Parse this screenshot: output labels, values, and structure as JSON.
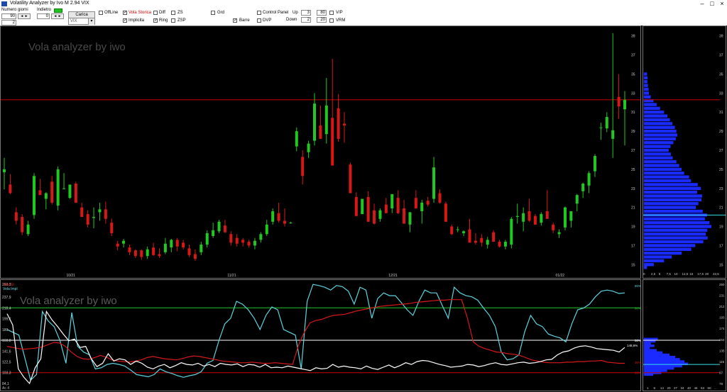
{
  "window": {
    "title": "Volatility Analyzer by Ivo M 2.94  VIX"
  },
  "toolbar": {
    "numero_giorni_label": "Numero giorni",
    "numero_giorni_value": "90",
    "numero_giorni_value2": "2",
    "indietro_label": "Indietro",
    "indietro_value": "0",
    "spin_arrows": "◄ ►",
    "carica_label": "Carica",
    "symbol_value": "VIX",
    "offline_label": "OffLine",
    "vola_storica_label": "Vola Storica",
    "implicita_label": "Implicita",
    "diff_label": "Diff",
    "ring_label": "Ring",
    "zs_label": "ZS",
    "zsp_label": "ZSP",
    "grid_label": "Grd",
    "barre_label": "Barre",
    "control_panel_label": "Control Panel",
    "dvp_label": "DVP",
    "up_label": "Up",
    "up_value1": "3",
    "up_value2": "80",
    "down_label": "Down",
    "down_value1": "2",
    "down_value2": "20",
    "vp_label": "V/P",
    "vrm_label": "VRM",
    "check_mark": "✓"
  },
  "main_chart": {
    "watermark": "Vola analyzer by iwo",
    "x_ticks": [
      "10/21",
      "11/21",
      "12/21",
      "01/22"
    ],
    "y_ticks": [
      "39",
      "37",
      "35",
      "33",
      "31",
      "29",
      "27",
      "25",
      "23",
      "21",
      "19",
      "17",
      "15"
    ],
    "ylim": [
      14.5,
      39.5
    ],
    "hline_red": 32.3,
    "colors": {
      "up": "#22c822",
      "down": "#d81818",
      "hline": "#c80000"
    }
  },
  "volume_profile": {
    "x_ticks": [
      "0",
      "2,5",
      "5",
      "7,5",
      "10",
      "12,5",
      "15",
      "17,5",
      "20",
      "22,5"
    ],
    "x_label": "10,6 15",
    "red_line": 32.3,
    "cyan_line": 20.2
  },
  "lower_chart": {
    "watermark": "Vola analyzer by iwo",
    "legend_line1": "Vola St",
    "legend_line2": "Vola Impl",
    "left_ticks": [
      "260,3",
      "237,9",
      "218,4",
      "199,2",
      "180",
      "160,8",
      "141,6",
      "122,5",
      "103,3",
      "84,1"
    ],
    "right_ticks": [
      "250",
      "231",
      "212",
      "193",
      "174",
      "154",
      "135",
      "116",
      "97",
      "78"
    ],
    "bottom_left": "Ac 4",
    "pct_labels": {
      "top": "90%",
      "green": "80%",
      "white": "50%",
      "white_value": "148,6%",
      "red_mid": "30%",
      "red_low": "20%"
    },
    "hist_x_ticks": [
      "1",
      "8",
      "14",
      "20",
      "27",
      "34",
      "40",
      "46",
      "53",
      "60",
      "..."
    ]
  },
  "chart_data": {
    "type": "candlestick",
    "title": "Vola analyzer by iwo",
    "symbol": "VIX",
    "candles": [
      {
        "o": 24.7,
        "h": 26.2,
        "l": 22.9,
        "c": 25.0
      },
      {
        "o": 23.4,
        "h": 24.5,
        "l": 22.4,
        "c": 22.5
      },
      {
        "o": 20.5,
        "h": 21.0,
        "l": 19.2,
        "c": 19.6
      },
      {
        "o": 20.0,
        "h": 20.3,
        "l": 18.1,
        "c": 18.4
      },
      {
        "o": 18.2,
        "h": 19.6,
        "l": 18.0,
        "c": 19.2
      },
      {
        "o": 20.2,
        "h": 24.6,
        "l": 19.8,
        "c": 24.3
      },
      {
        "o": 22.8,
        "h": 24.0,
        "l": 22.5,
        "c": 22.3
      },
      {
        "o": 21.9,
        "h": 22.6,
        "l": 20.8,
        "c": 22.5
      },
      {
        "o": 23.7,
        "h": 24.3,
        "l": 21.3,
        "c": 21.5
      },
      {
        "o": 21.2,
        "h": 25.3,
        "l": 20.7,
        "c": 25.0
      },
      {
        "o": 23.0,
        "h": 24.6,
        "l": 22.9,
        "c": 23.0
      },
      {
        "o": 22.0,
        "h": 23.3,
        "l": 21.9,
        "c": 23.4
      },
      {
        "o": 23.5,
        "h": 23.7,
        "l": 21.5,
        "c": 21.5
      },
      {
        "o": 21.0,
        "h": 21.5,
        "l": 20.0,
        "c": 20.0
      },
      {
        "o": 20.3,
        "h": 20.7,
        "l": 18.9,
        "c": 19.2
      },
      {
        "o": 19.9,
        "h": 21.0,
        "l": 18.8,
        "c": 20.0
      },
      {
        "o": 20.5,
        "h": 21.5,
        "l": 19.6,
        "c": 20.8
      },
      {
        "o": 20.8,
        "h": 21.6,
        "l": 19.3,
        "c": 19.8
      },
      {
        "o": 19.4,
        "h": 19.8,
        "l": 18.0,
        "c": 18.3
      },
      {
        "o": 17.2,
        "h": 17.5,
        "l": 16.5,
        "c": 16.9
      },
      {
        "o": 17.2,
        "h": 17.7,
        "l": 16.8,
        "c": 17.5
      },
      {
        "o": 16.8,
        "h": 17.1,
        "l": 16.0,
        "c": 16.3
      },
      {
        "o": 16.5,
        "h": 16.6,
        "l": 15.7,
        "c": 15.9
      },
      {
        "o": 16.5,
        "h": 16.6,
        "l": 15.5,
        "c": 15.8
      },
      {
        "o": 15.9,
        "h": 16.9,
        "l": 15.6,
        "c": 16.6
      },
      {
        "o": 16.8,
        "h": 17.3,
        "l": 15.9,
        "c": 16.0
      },
      {
        "o": 16.1,
        "h": 16.7,
        "l": 15.7,
        "c": 15.9
      },
      {
        "o": 16.3,
        "h": 17.8,
        "l": 16.1,
        "c": 17.2
      },
      {
        "o": 16.8,
        "h": 17.7,
        "l": 16.3,
        "c": 17.6
      },
      {
        "o": 17.6,
        "h": 17.8,
        "l": 16.4,
        "c": 16.9
      },
      {
        "o": 17.3,
        "h": 17.6,
        "l": 16.6,
        "c": 16.8
      },
      {
        "o": 16.7,
        "h": 17.1,
        "l": 15.8,
        "c": 16.0
      },
      {
        "o": 16.1,
        "h": 16.6,
        "l": 15.4,
        "c": 15.6
      },
      {
        "o": 16.3,
        "h": 17.4,
        "l": 16.0,
        "c": 17.1
      },
      {
        "o": 17.1,
        "h": 18.6,
        "l": 16.8,
        "c": 18.3
      },
      {
        "o": 18.0,
        "h": 19.4,
        "l": 17.8,
        "c": 18.6
      },
      {
        "o": 18.5,
        "h": 19.7,
        "l": 18.3,
        "c": 19.5
      },
      {
        "o": 19.1,
        "h": 19.7,
        "l": 18.3,
        "c": 18.4
      },
      {
        "o": 18.2,
        "h": 18.5,
        "l": 17.0,
        "c": 17.3
      },
      {
        "o": 17.8,
        "h": 18.2,
        "l": 16.9,
        "c": 17.2
      },
      {
        "o": 17.6,
        "h": 17.8,
        "l": 16.9,
        "c": 17.3
      },
      {
        "o": 17.4,
        "h": 17.6,
        "l": 16.8,
        "c": 17.0
      },
      {
        "o": 17.0,
        "h": 17.8,
        "l": 16.6,
        "c": 17.5
      },
      {
        "o": 17.6,
        "h": 18.4,
        "l": 17.3,
        "c": 18.2
      },
      {
        "o": 18.2,
        "h": 19.7,
        "l": 18.0,
        "c": 19.2
      },
      {
        "o": 19.5,
        "h": 20.9,
        "l": 19.2,
        "c": 20.6
      },
      {
        "o": 20.4,
        "h": 21.5,
        "l": 19.4,
        "c": 19.6
      },
      {
        "o": 19.6,
        "h": 20.9,
        "l": 19.0,
        "c": 19.3
      },
      {
        "o": 19.4,
        "h": 19.5,
        "l": 19.3,
        "c": 19.4
      },
      {
        "o": 27.4,
        "h": 29.4,
        "l": 26.9,
        "c": 29.0
      },
      {
        "o": 26.3,
        "h": 27.0,
        "l": 23.4,
        "c": 24.3
      },
      {
        "o": 26.8,
        "h": 28.0,
        "l": 26.2,
        "c": 27.7
      },
      {
        "o": 28.0,
        "h": 33.0,
        "l": 27.5,
        "c": 31.9
      },
      {
        "o": 29.6,
        "h": 31.7,
        "l": 28.4,
        "c": 28.2
      },
      {
        "o": 28.7,
        "h": 34.6,
        "l": 27.7,
        "c": 31.7
      },
      {
        "o": 30.4,
        "h": 36.6,
        "l": 25.4,
        "c": 25.4
      },
      {
        "o": 31.4,
        "h": 32.9,
        "l": 27.9,
        "c": 28.2
      },
      {
        "o": 29.8,
        "h": 31.0,
        "l": 27.8,
        "c": 29.6
      },
      {
        "o": 25.5,
        "h": 25.7,
        "l": 22.6,
        "c": 22.5
      },
      {
        "o": 22.1,
        "h": 22.6,
        "l": 20.1,
        "c": 20.1
      },
      {
        "o": 20.3,
        "h": 21.9,
        "l": 20.3,
        "c": 21.9
      },
      {
        "o": 22.1,
        "h": 22.7,
        "l": 19.5,
        "c": 19.5
      },
      {
        "o": 20.7,
        "h": 21.4,
        "l": 19.2,
        "c": 19.3
      },
      {
        "o": 19.8,
        "h": 20.9,
        "l": 19.5,
        "c": 20.7
      },
      {
        "o": 21.3,
        "h": 22.0,
        "l": 20.4,
        "c": 20.4
      },
      {
        "o": 20.9,
        "h": 22.3,
        "l": 20.4,
        "c": 22.4
      },
      {
        "o": 22.0,
        "h": 22.8,
        "l": 20.3,
        "c": 20.4
      },
      {
        "o": 20.9,
        "h": 21.8,
        "l": 19.3,
        "c": 19.3
      },
      {
        "o": 19.2,
        "h": 20.5,
        "l": 18.4,
        "c": 20.5
      },
      {
        "o": 22.0,
        "h": 22.8,
        "l": 20.9,
        "c": 20.9
      },
      {
        "o": 20.6,
        "h": 21.8,
        "l": 19.3,
        "c": 21.5
      },
      {
        "o": 21.7,
        "h": 22.1,
        "l": 21.1,
        "c": 21.3
      },
      {
        "o": 21.9,
        "h": 26.3,
        "l": 21.5,
        "c": 25.2
      },
      {
        "o": 22.5,
        "h": 22.9,
        "l": 21.4,
        "c": 21.5
      },
      {
        "o": 21.4,
        "h": 21.6,
        "l": 19.5,
        "c": 19.5
      },
      {
        "o": 19.0,
        "h": 19.2,
        "l": 18.1,
        "c": 18.2
      },
      {
        "o": 18.7,
        "h": 19.0,
        "l": 18.4,
        "c": 18.7
      },
      {
        "o": 18.3,
        "h": 18.6,
        "l": 18.0,
        "c": 18.5
      },
      {
        "o": 18.7,
        "h": 19.8,
        "l": 17.3,
        "c": 17.3
      },
      {
        "o": 17.5,
        "h": 18.3,
        "l": 17.1,
        "c": 17.3
      },
      {
        "o": 17.8,
        "h": 18.2,
        "l": 16.9,
        "c": 17.3
      },
      {
        "o": 17.1,
        "h": 17.9,
        "l": 16.7,
        "c": 17.6
      },
      {
        "o": 18.4,
        "h": 18.6,
        "l": 17.4,
        "c": 17.4
      },
      {
        "o": 17.4,
        "h": 17.6,
        "l": 16.8,
        "c": 16.9
      },
      {
        "o": 16.9,
        "h": 17.6,
        "l": 16.6,
        "c": 17.4
      },
      {
        "o": 17.1,
        "h": 20.0,
        "l": 16.7,
        "c": 19.8
      },
      {
        "o": 20.0,
        "h": 21.4,
        "l": 19.3,
        "c": 20.1
      },
      {
        "o": 19.5,
        "h": 21.0,
        "l": 18.5,
        "c": 20.4
      },
      {
        "o": 20.6,
        "h": 21.9,
        "l": 19.5,
        "c": 19.6
      },
      {
        "o": 20.1,
        "h": 20.3,
        "l": 19.2,
        "c": 19.2
      },
      {
        "o": 19.4,
        "h": 20.5,
        "l": 19.1,
        "c": 20.3
      },
      {
        "o": 20.6,
        "h": 22.8,
        "l": 19.8,
        "c": 19.8
      },
      {
        "o": 19.2,
        "h": 19.4,
        "l": 18.3,
        "c": 18.6
      },
      {
        "o": 18.2,
        "h": 18.7,
        "l": 17.8,
        "c": 18.4
      },
      {
        "o": 18.9,
        "h": 21.1,
        "l": 18.6,
        "c": 21.0
      },
      {
        "o": 19.6,
        "h": 20.6,
        "l": 18.9,
        "c": 20.6
      },
      {
        "o": 21.4,
        "h": 22.4,
        "l": 20.6,
        "c": 22.3
      },
      {
        "o": 22.7,
        "h": 23.6,
        "l": 22.0,
        "c": 23.5
      },
      {
        "o": 23.3,
        "h": 24.8,
        "l": 22.5,
        "c": 24.6
      },
      {
        "o": 24.8,
        "h": 26.6,
        "l": 24.2,
        "c": 26.4
      },
      {
        "o": 29.4,
        "h": 29.9,
        "l": 28.1,
        "c": 29.4
      },
      {
        "o": 29.3,
        "h": 31.0,
        "l": 28.9,
        "c": 30.5
      },
      {
        "o": 28.2,
        "h": 39.3,
        "l": 26.2,
        "c": 29.1
      },
      {
        "o": 32.6,
        "h": 35.0,
        "l": 30.3,
        "c": 31.6
      },
      {
        "o": 31.3,
        "h": 33.2,
        "l": 27.5,
        "c": 32.3
      }
    ],
    "volume_profile": [
      {
        "p": 35.0,
        "v": 1.0
      },
      {
        "p": 34.6,
        "v": 1.2
      },
      {
        "p": 34.2,
        "v": 1.1
      },
      {
        "p": 33.8,
        "v": 1.3
      },
      {
        "p": 33.4,
        "v": 1.5
      },
      {
        "p": 33.0,
        "v": 1.6
      },
      {
        "p": 32.6,
        "v": 2.2
      },
      {
        "p": 32.2,
        "v": 3.1
      },
      {
        "p": 31.8,
        "v": 4.1
      },
      {
        "p": 31.4,
        "v": 5.2
      },
      {
        "p": 31.0,
        "v": 6.5
      },
      {
        "p": 30.6,
        "v": 7.6
      },
      {
        "p": 30.2,
        "v": 8.4
      },
      {
        "p": 29.8,
        "v": 9.2
      },
      {
        "p": 29.4,
        "v": 10.0
      },
      {
        "p": 29.0,
        "v": 10.5
      },
      {
        "p": 28.6,
        "v": 10.8
      },
      {
        "p": 28.2,
        "v": 10.3
      },
      {
        "p": 27.8,
        "v": 9.5
      },
      {
        "p": 27.4,
        "v": 8.6
      },
      {
        "p": 27.0,
        "v": 8.0
      },
      {
        "p": 26.6,
        "v": 8.7
      },
      {
        "p": 26.2,
        "v": 9.3
      },
      {
        "p": 25.8,
        "v": 10.5
      },
      {
        "p": 25.4,
        "v": 11.4
      },
      {
        "p": 25.0,
        "v": 12.2
      },
      {
        "p": 24.6,
        "v": 13.0
      },
      {
        "p": 24.2,
        "v": 14.6
      },
      {
        "p": 23.8,
        "v": 15.2
      },
      {
        "p": 23.4,
        "v": 17.4
      },
      {
        "p": 23.0,
        "v": 18.4
      },
      {
        "p": 22.6,
        "v": 17.2
      },
      {
        "p": 22.2,
        "v": 18.8
      },
      {
        "p": 21.8,
        "v": 18.6
      },
      {
        "p": 21.4,
        "v": 17.6
      },
      {
        "p": 21.0,
        "v": 16.8
      },
      {
        "p": 20.6,
        "v": 19.0
      },
      {
        "p": 20.2,
        "v": 20.4
      },
      {
        "p": 19.8,
        "v": 19.7
      },
      {
        "p": 19.4,
        "v": 21.2
      },
      {
        "p": 19.0,
        "v": 21.8
      },
      {
        "p": 18.6,
        "v": 20.5
      },
      {
        "p": 18.2,
        "v": 20.0
      },
      {
        "p": 17.8,
        "v": 20.6
      },
      {
        "p": 17.4,
        "v": 19.2
      },
      {
        "p": 17.0,
        "v": 16.6
      },
      {
        "p": 16.6,
        "v": 15.3
      },
      {
        "p": 16.2,
        "v": 12.2
      },
      {
        "p": 15.8,
        "v": 9.0
      },
      {
        "p": 15.4,
        "v": 6.5
      },
      {
        "p": 15.0,
        "v": 3.2
      },
      {
        "p": 14.7,
        "v": 1.0
      }
    ],
    "vola_storica": [
      150,
      148,
      146,
      145,
      146,
      147,
      149,
      153,
      157,
      156,
      150,
      140,
      132,
      128,
      127,
      130,
      134,
      131,
      126,
      124,
      123,
      122,
      124,
      126,
      130,
      132,
      130,
      128,
      127,
      126,
      128,
      131,
      133,
      132,
      130,
      128,
      126,
      124,
      123,
      122,
      121,
      121,
      122,
      121,
      120,
      120,
      121,
      120,
      119,
      118,
      152,
      175,
      192,
      196,
      198,
      202,
      205,
      206,
      207,
      210,
      213,
      215,
      217,
      219,
      221,
      222,
      223,
      224,
      225,
      226,
      228,
      229,
      230,
      231,
      232,
      232,
      233,
      233,
      233,
      200,
      158,
      150,
      146,
      143,
      140,
      139,
      137,
      136,
      134,
      130,
      126,
      124,
      122,
      121,
      121,
      121,
      122,
      122,
      123,
      123,
      124,
      124,
      125,
      122,
      121,
      120,
      120
    ],
    "vola_impl": [
      208,
      188,
      110,
      95,
      82,
      112,
      128,
      212,
      197,
      185,
      172,
      160,
      163,
      148,
      150,
      128,
      114,
      120,
      137,
      124,
      128,
      126,
      118,
      124,
      120,
      113,
      110,
      115,
      118,
      112,
      116,
      121,
      118,
      117,
      120,
      115,
      118,
      114,
      120,
      118,
      117,
      119,
      114,
      118,
      117,
      113,
      118,
      112,
      113,
      112,
      115,
      113,
      111,
      109,
      107,
      112,
      110,
      111,
      118,
      113,
      115,
      113,
      112,
      110,
      115,
      111,
      109,
      113,
      117,
      112,
      116,
      121,
      118,
      123,
      125,
      124,
      121,
      118,
      116,
      113,
      114,
      115,
      118,
      117,
      114,
      116,
      119,
      121,
      118,
      117,
      119,
      121,
      122,
      120,
      121,
      123,
      126,
      127,
      135,
      140,
      142,
      147,
      150,
      151,
      149,
      146,
      145,
      144,
      143,
      140,
      148
    ],
    "vola_impl_cyan": [
      180,
      175,
      170,
      130,
      90,
      100,
      212,
      195,
      185,
      160,
      120,
      210,
      150,
      140,
      135,
      110,
      112,
      118,
      120,
      118,
      115,
      108,
      100,
      98,
      96,
      100,
      110,
      105,
      102,
      98,
      95,
      98,
      100,
      105,
      120,
      125,
      160,
      190,
      200,
      230,
      225,
      215,
      200,
      180,
      205,
      220,
      215,
      180,
      175,
      170,
      110,
      230,
      260,
      258,
      255,
      250,
      258,
      256,
      248,
      225,
      255,
      250,
      200,
      235,
      245,
      240,
      240,
      228,
      215,
      205,
      230,
      250,
      245,
      245,
      222,
      200,
      255,
      245,
      240,
      238,
      232,
      218,
      205,
      185,
      140,
      126,
      128,
      135,
      176,
      205,
      190,
      185,
      172,
      168,
      165,
      158,
      190,
      215,
      218,
      225,
      238,
      248,
      250,
      248,
      244,
      245
    ],
    "lower_lines": {
      "green": 218.4,
      "white": 160.8,
      "red": 103.3
    },
    "lower_hist": [
      {
        "p": 163,
        "v": 12
      },
      {
        "p": 159,
        "v": 10
      },
      {
        "p": 155,
        "v": 6
      },
      {
        "p": 151,
        "v": 9
      },
      {
        "p": 147,
        "v": 5
      },
      {
        "p": 143,
        "v": 11
      },
      {
        "p": 139,
        "v": 16
      },
      {
        "p": 135,
        "v": 22
      },
      {
        "p": 131,
        "v": 27
      },
      {
        "p": 127,
        "v": 31
      },
      {
        "p": 123,
        "v": 35
      },
      {
        "p": 119,
        "v": 38
      },
      {
        "p": 115,
        "v": 33
      },
      {
        "p": 111,
        "v": 26
      },
      {
        "p": 107,
        "v": 20
      },
      {
        "p": 103,
        "v": 15
      },
      {
        "p": 100,
        "v": 8
      }
    ]
  }
}
